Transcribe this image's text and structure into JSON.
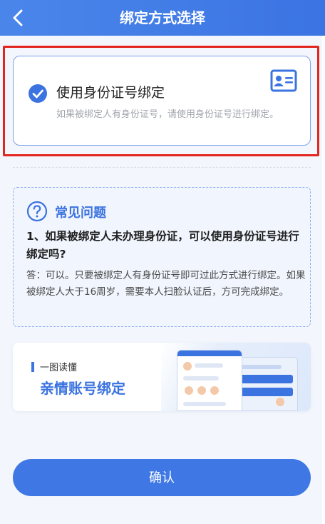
{
  "header": {
    "title": "绑定方式选择",
    "back_icon": "chevron-left-icon"
  },
  "option": {
    "title": "使用身份证号绑定",
    "description": "如果被绑定人有身份证号，请使用身份证号进行绑定。",
    "selected": true,
    "check_icon": "check-circle-icon",
    "card_icon": "id-card-icon"
  },
  "faq": {
    "icon": "question-circle-icon",
    "title": "常见问题",
    "question": "1、如果被绑定人未办理身份证，可以使用身份证号进行绑定吗?",
    "answer": "答：可以。只要被绑定人有身份证号即可过此方式进行绑定。如果被绑定人大于16周岁，需要本人扫脸认证后，方可完成绑定。"
  },
  "banner": {
    "kicker": "一图读懂",
    "title": "亲情账号绑定"
  },
  "confirm_label": "确认",
  "colors": {
    "primary": "#3b73e0",
    "highlight_border": "#e3251f",
    "page_bg": "#f3f6fc"
  }
}
